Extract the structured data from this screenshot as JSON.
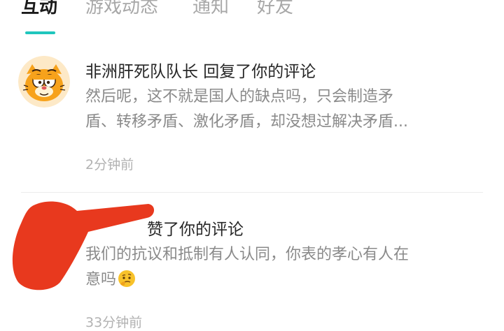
{
  "tabs": [
    {
      "label": "互动",
      "active": true
    },
    {
      "label": "游戏动态",
      "active": false
    },
    {
      "label": "通知",
      "active": false
    },
    {
      "label": "好友",
      "active": false
    }
  ],
  "colors": {
    "accent": "#20c6bd",
    "redaction": "#e8391e"
  },
  "notifications": [
    {
      "avatar_icon": "garfield-avatar-icon",
      "title": "非洲肝死队队长 回复了你的评论",
      "body_lines": [
        "然后呢，这不就是国人的缺点吗，只会制造矛",
        "盾、转移矛盾、激化矛盾，却没想过解决矛盾..."
      ],
      "time": "2分钟前"
    },
    {
      "title_visible": "赞了你的评论",
      "body_lines": [
        "我们的抗议和抵制有人认同，你表的孝心有人在",
        "意吗"
      ],
      "emoji_icon": "thinking-face-emoji-icon",
      "time": "33分钟前"
    }
  ]
}
